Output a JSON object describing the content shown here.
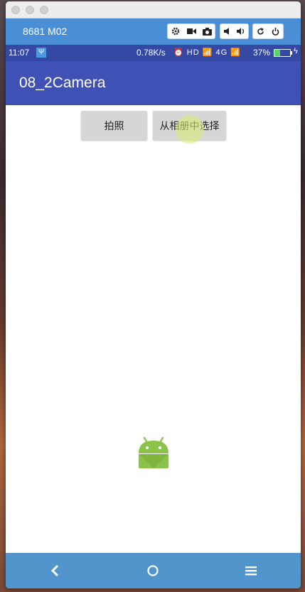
{
  "device": {
    "name": "8681 M02",
    "controls": [
      "settings-icon",
      "video-icon",
      "camera-icon",
      "volume-down-icon",
      "volume-up-icon",
      "rotate-icon",
      "power-icon"
    ]
  },
  "status_bar": {
    "time": "11:07",
    "usb": "Ψ",
    "net_speed": "0.78K/s",
    "indicators": "⏰ HD 📶 4G 📶",
    "battery_percent": "37%",
    "battery_level": 0.37,
    "charging": "ϟ"
  },
  "app_bar": {
    "title": "08_2Camera"
  },
  "buttons": {
    "take_photo": "拍照",
    "choose_from_album": "从相册中选择"
  },
  "nav_bar": {
    "back": "back-icon",
    "home": "home-icon",
    "recents": "menu-icon"
  },
  "colors": {
    "device_toolbar": "#4a8fd6",
    "status_bar": "#3448a4",
    "app_bar": "#3f51b5",
    "nav_bar": "#5294cc",
    "android_green": "#8bc34a"
  }
}
